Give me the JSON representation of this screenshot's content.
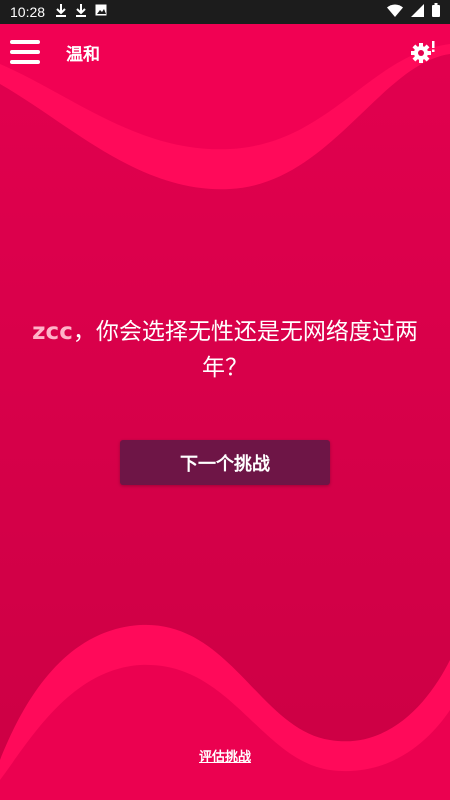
{
  "status_bar": {
    "time": "10:28",
    "left_icons": [
      "download-icon",
      "download-icon",
      "image-icon"
    ],
    "right_icons": [
      "wifi-icon",
      "signal-icon",
      "battery-icon"
    ]
  },
  "app_bar": {
    "title": "温和",
    "menu_icon": "hamburger-menu-icon",
    "settings_icon": "settings-alert-icon"
  },
  "question": {
    "name": "zcc",
    "text": "，你会选择无性还是无网络度过两年？"
  },
  "buttons": {
    "next_challenge": "下一个挑战",
    "rate_challenge": "评估挑战"
  },
  "colors": {
    "background": "#d6004a",
    "wave_accent": "#ff0a5a",
    "button_bg": "#6e1546",
    "name_highlight": "#ffb3c8",
    "status_bar": "#1c1c1c"
  }
}
